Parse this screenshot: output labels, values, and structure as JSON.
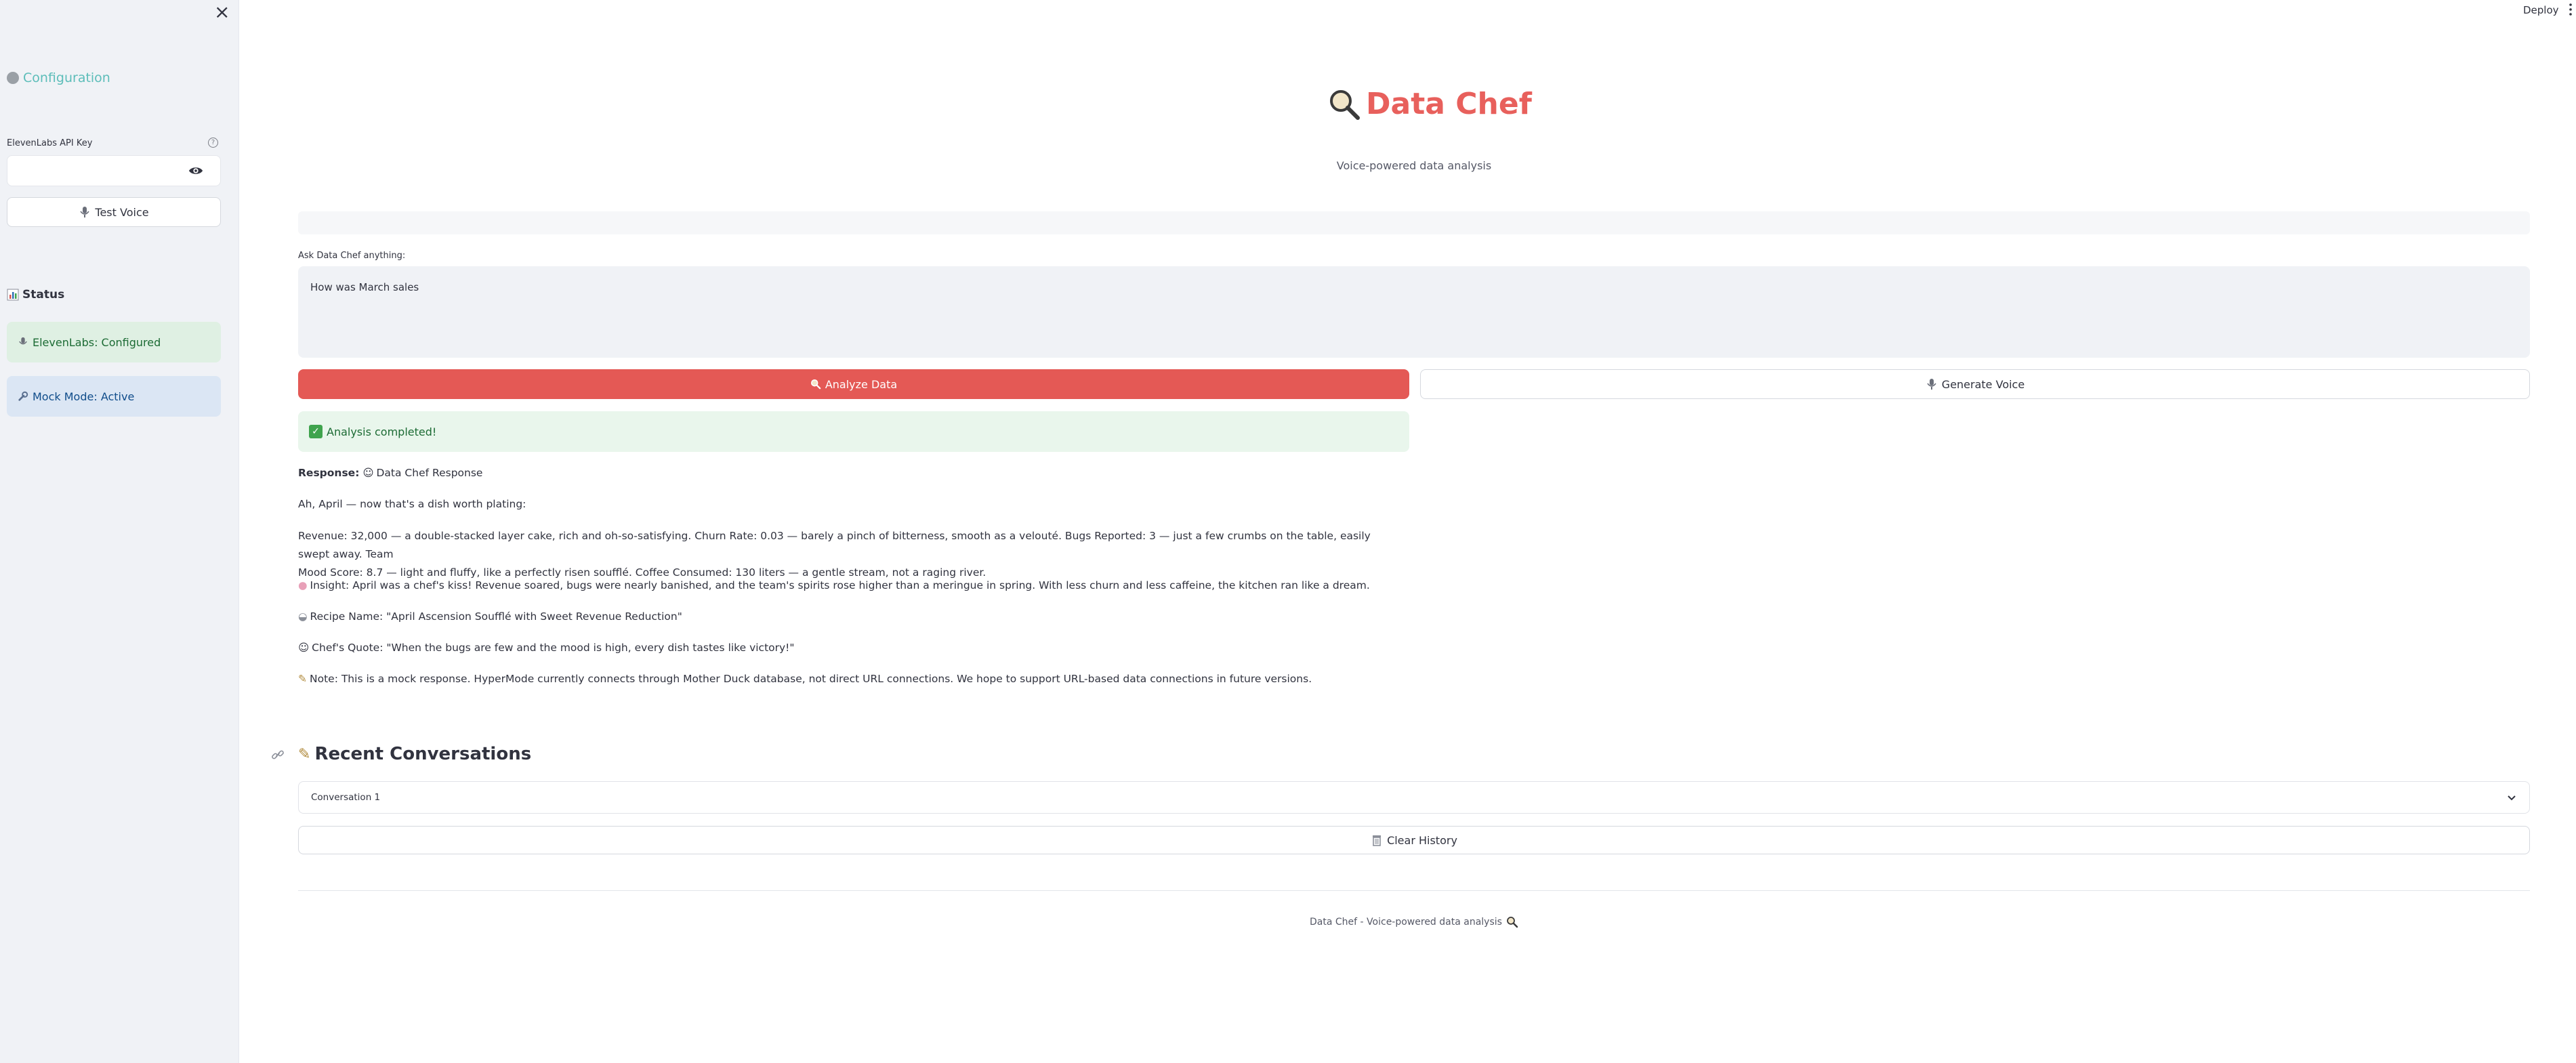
{
  "sidebar": {
    "close_label": "×",
    "config_title": "Configuration",
    "api_key_label": "ElevenLabs API Key",
    "help_label": "?",
    "api_key_value": "",
    "test_voice_label": "Test Voice",
    "status_heading": "Status",
    "status_elevenlabs": "ElevenLabs: Configured",
    "status_mock": "Mock Mode: Active"
  },
  "header": {
    "deploy_label": "Deploy"
  },
  "main": {
    "title": "Data Chef",
    "subtitle": "Voice-powered data analysis",
    "ask_label": "Ask Data Chef anything:",
    "ask_value": "How was March sales",
    "analyze_label": "Analyze Data",
    "generate_voice_label": "Generate Voice",
    "success_text": "Analysis completed!",
    "response_label": "Response:",
    "response_heading": "Data Chef Response",
    "response_intro": "Ah, April — now that's a dish worth plating:",
    "response_metrics_1": "Revenue: 32,000 — a double-stacked layer cake, rich and oh-so-satisfying. Churn Rate: 0.03 — barely a pinch of bitterness, smooth as a velouté. Bugs Reported: 3 — just a few crumbs on the table, easily swept away. Team",
    "response_metrics_2": "Mood Score: 8.7 — light and fluffy, like a perfectly risen soufflé. Coffee Consumed: 130 liters — a gentle stream, not a raging river.",
    "response_insight": "Insight: April was a chef's kiss! Revenue soared, bugs were nearly banished, and the team's spirits rose higher than a meringue in spring. With less churn and less caffeine, the kitchen ran like a dream.",
    "response_recipe": "Recipe Name: \"April Ascension Soufflé with Sweet Revenue Reduction\"",
    "response_quote": "Chef's Quote: \"When the bugs are few and the mood is high, every dish tastes like victory!\"",
    "response_note": "Note: This is a mock response. HyperMode currently connects through Mother Duck database, not direct URL connections. We hope to support URL-based data connections in future versions.",
    "recent_title": "Recent Conversations",
    "conversation_1": "Conversation 1",
    "clear_history_label": "Clear History",
    "footer": "Data Chef - Voice-powered data analysis"
  },
  "colors": {
    "accent": "#e8605c",
    "analyze_button": "#e45955",
    "config_title": "#5cbdb9",
    "sidebar_bg": "#f0f2f6",
    "success_bg": "#e9f6ec",
    "info_bg": "#dbe6f4"
  },
  "icons": {
    "title": "magnifier-icon",
    "config": "gear-icon",
    "test_voice": "microphone-icon",
    "status": "bar-chart-icon",
    "elevenlabs": "microphone-icon",
    "mock": "wrench-icon",
    "analyze": "magnifier-icon",
    "generate_voice": "microphone-icon",
    "success": "check-icon",
    "response": "chef-icon",
    "insight": "brain-icon",
    "recipe": "bowl-icon",
    "quote": "chef-icon",
    "note": "memo-icon",
    "recent": "memo-icon",
    "clear": "trash-icon"
  }
}
